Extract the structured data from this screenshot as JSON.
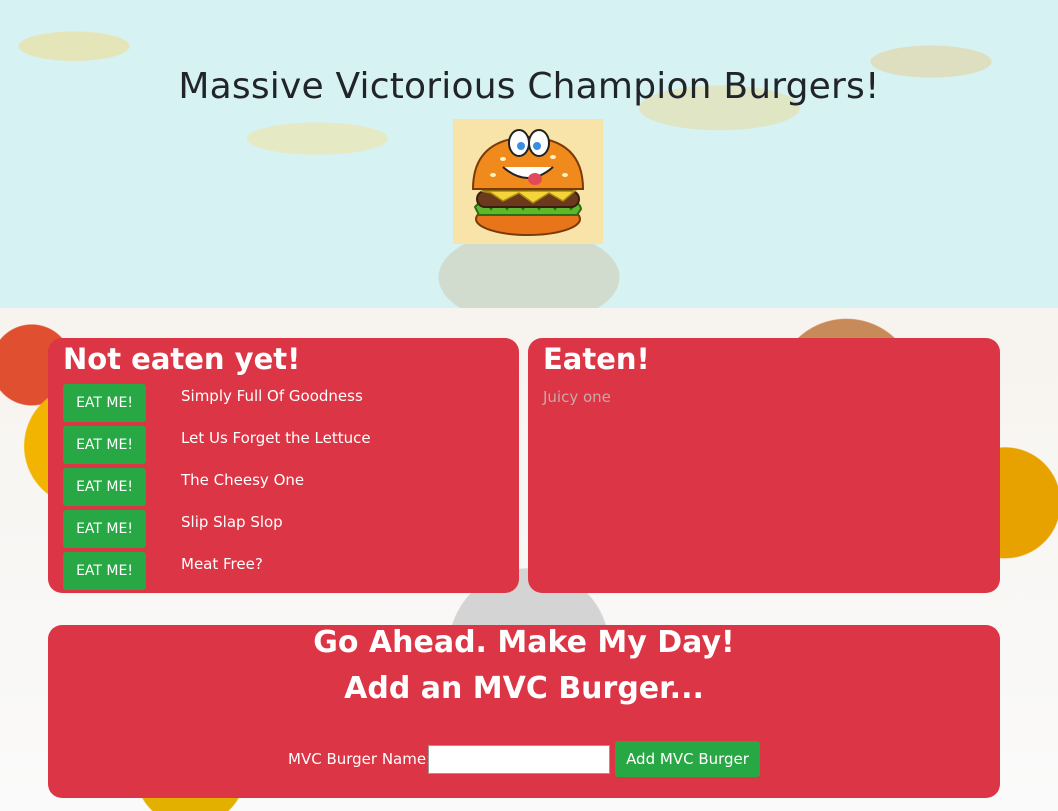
{
  "header": {
    "title": "Massive Victorious Champion Burgers!",
    "logo_icon": "burger-mascot-icon"
  },
  "not_eaten": {
    "title": "Not eaten yet!",
    "button_label": "EAT ME!",
    "items": [
      {
        "name": "Simply Full Of Goodness"
      },
      {
        "name": "Let Us Forget the Lettuce"
      },
      {
        "name": "The Cheesy One"
      },
      {
        "name": "Slip Slap Slop"
      },
      {
        "name": "Meat Free?"
      }
    ]
  },
  "eaten": {
    "title": "Eaten!",
    "items": [
      {
        "name": "Juicy one"
      }
    ]
  },
  "add_form": {
    "title_line1": "Go Ahead. Make My Day!",
    "title_line2": "Add an MVC Burger...",
    "name_label": "MVC Burger Name:",
    "name_value": "",
    "submit_label": "Add MVC Burger"
  },
  "colors": {
    "panel": "#dc3545",
    "button": "#28a745",
    "header_bg": "#d6f2f3"
  }
}
